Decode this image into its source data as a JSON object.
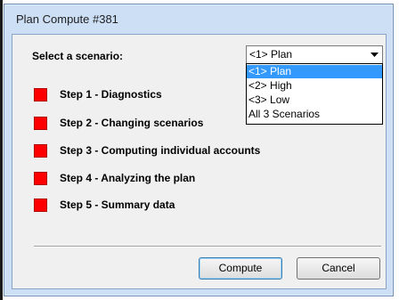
{
  "window": {
    "title": "Plan Compute #381"
  },
  "scenario": {
    "label": "Select a scenario:",
    "selected": "<1> Plan",
    "options": [
      "<1> Plan",
      "<2> High",
      "<3> Low",
      "All 3 Scenarios"
    ],
    "highlighted_index": 0
  },
  "steps": [
    {
      "label": "Step 1 - Diagnostics",
      "status_color": "#ff0000"
    },
    {
      "label": "Step 2 - Changing scenarios",
      "status_color": "#ff0000"
    },
    {
      "label": "Step 3 - Computing individual accounts",
      "status_color": "#ff0000"
    },
    {
      "label": "Step 4 - Analyzing the plan",
      "status_color": "#ff0000"
    },
    {
      "label": "Step 5 - Summary data",
      "status_color": "#ff0000"
    }
  ],
  "buttons": {
    "compute": "Compute",
    "cancel": "Cancel"
  },
  "colors": {
    "selection": "#3399ff",
    "frame": "#ccdff5"
  }
}
